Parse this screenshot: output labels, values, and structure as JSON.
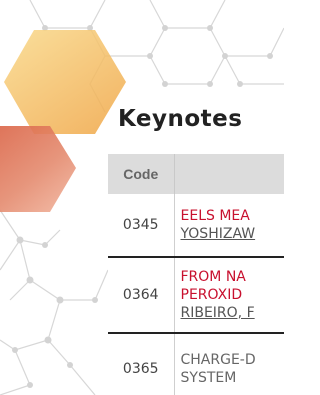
{
  "page": {
    "title": "Keynotes"
  },
  "colors": {
    "accent_red": "#c8102e",
    "hexagon_yellow": "#f7c86a",
    "hexagon_red": "#e07a5f"
  },
  "table": {
    "headers": {
      "code": "Code",
      "title": ""
    },
    "rows": [
      {
        "code": "0345",
        "title_lines": [
          "EELS MEA"
        ],
        "author": "YOSHIZAW"
      },
      {
        "code": "0364",
        "title_lines": [
          "FROM NA",
          "PEROXID"
        ],
        "author": "RIBEIRO, F"
      },
      {
        "code": "0365",
        "title_lines": [
          "CHARGE-D",
          "SYSTEM"
        ],
        "author": ""
      }
    ]
  }
}
